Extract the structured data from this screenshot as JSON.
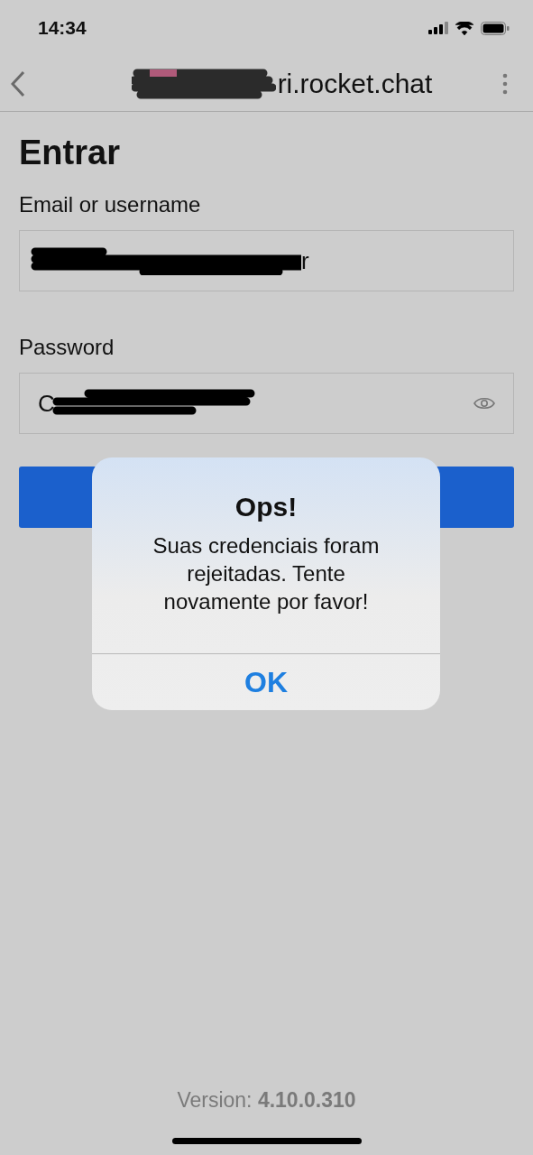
{
  "status_bar": {
    "time": "14:34"
  },
  "header": {
    "title": "ri.rocket.chat"
  },
  "title": "Entrar",
  "fields": [
    {
      "label": "Email or username",
      "value_end": "r",
      "kind": "text"
    },
    {
      "label": "Password",
      "value_start": "C",
      "kind": "password"
    }
  ],
  "alert": {
    "title": "Ops!",
    "message": "Suas credenciais foram rejeitadas. Tente novamente por favor!",
    "button": "OK"
  },
  "version": "Version: **4.10.0.310**"
}
